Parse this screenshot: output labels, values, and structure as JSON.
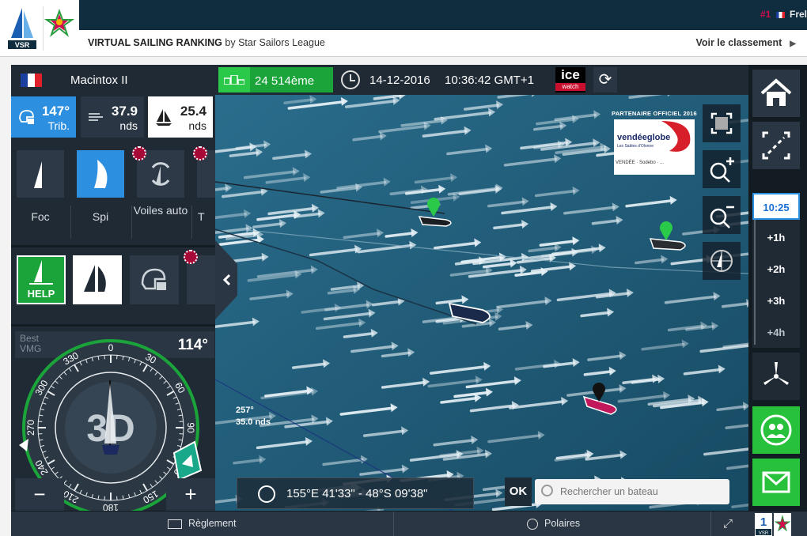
{
  "banner": {
    "rank_num": "#1",
    "rank_name": "Frel",
    "title_bold": "VIRTUAL SAILING RANKING",
    "title_rest": " by Star Sailors League",
    "link": "Voir le classement",
    "vsr_text": "VSR",
    "ssl_text": "STAR SAILORS LEAGUE"
  },
  "topbar": {
    "boat_name": "Macintox II",
    "ranking": "24 514ème",
    "date": "14-12-2016",
    "time": "10:36:42 GMT+1",
    "ice_top": "ice",
    "ice_bottom": "watch"
  },
  "stats": {
    "heading_value": "147°",
    "heading_unit": "Trib.",
    "wind_speed": "37.9",
    "wind_unit": "nds",
    "boat_speed": "25.4",
    "boat_unit": "nds"
  },
  "sails": [
    {
      "label": "Foc"
    },
    {
      "label": "Spi"
    },
    {
      "label": "Voiles auto"
    },
    {
      "label": "T"
    }
  ],
  "controls": {
    "help_label": "HELP",
    "best_vmg_line1": "Best",
    "best_vmg_line2": "VMG",
    "angle": "114°",
    "mode_3d": "3D",
    "minus": "−",
    "plus": "+"
  },
  "compass": {
    "labels": [
      "0",
      "30",
      "60",
      "90",
      "120",
      "150",
      "180",
      "210",
      "240",
      "270",
      "300",
      "330"
    ]
  },
  "map": {
    "wind_direction": "257°",
    "wind_speed": "35.0 nds",
    "coordinates": "155°E 41'33\" - 48°S 09'38\"",
    "ok_label": "OK",
    "search_placeholder": "Rechercher un bateau",
    "partner_header": "PARTENAIRE OFFICIEL 2016",
    "partner_logo": "vendéeglobe",
    "partner_sub": "Les Sables d'Olonne",
    "partner_sponsors": "VENDÉE · Sodebo · ..."
  },
  "timeline": [
    {
      "label": "10:25",
      "current": true
    },
    {
      "label": "+1h",
      "current": false
    },
    {
      "label": "+2h",
      "current": false
    },
    {
      "label": "+3h",
      "current": false
    },
    {
      "label": "+4h",
      "current": false
    }
  ],
  "bottom": {
    "reglement": "Règlement",
    "polaires": "Polaires",
    "vsr_num": "1",
    "vsr_tag": "VSR"
  },
  "colors": {
    "accent_blue": "#2d8fe0",
    "green": "#27c13c",
    "map_sea": "#1e5570",
    "panel": "#1f2a35",
    "brand_red": "#d10b4d"
  }
}
